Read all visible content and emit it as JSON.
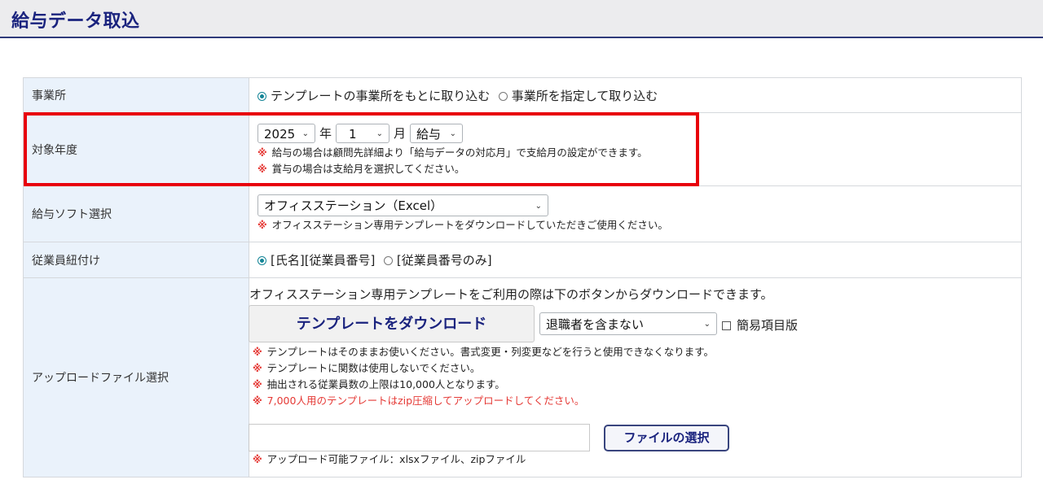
{
  "header": {
    "title": "給与データ取込"
  },
  "office": {
    "label": "事業所",
    "options": [
      {
        "label": "テンプレートの事業所をもとに取り込む",
        "checked": true
      },
      {
        "label": "事業所を指定して取り込む",
        "checked": false
      }
    ]
  },
  "target_year": {
    "label": "対象年度",
    "year": "2025",
    "year_unit": "年",
    "month": "1",
    "month_unit": "月",
    "kind": "給与",
    "notes": [
      "給与の場合は顧問先詳細より「給与データの対応月」で支給月の設定ができます。",
      "賞与の場合は支給月を選択してください。"
    ]
  },
  "software": {
    "label": "給与ソフト選択",
    "selected": "オフィスステーション（Excel）",
    "note": "オフィスステーション専用テンプレートをダウンロードしていただきご使用ください。"
  },
  "employee_link": {
    "label": "従業員紐付け",
    "options": [
      {
        "label": "[氏名][従業員番号]",
        "checked": true
      },
      {
        "label": "[従業員番号のみ]",
        "checked": false
      }
    ]
  },
  "upload": {
    "label": "アップロードファイル選択",
    "intro": "オフィスステーション専用テンプレートをご利用の際は下のボタンからダウンロードできます。",
    "download_button": "テンプレートをダウンロード",
    "retire_select": "退職者を含まない",
    "simple_checkbox": "簡易項目版",
    "notes": [
      "テンプレートはそのままお使いください。書式変更・列変更などを行うと使用できなくなります。",
      "テンプレートに関数は使用しないでください。",
      "抽出される従業員数の上限は10,000人となります。",
      "7,000人用のテンプレートはzip圧縮してアップロードしてください。"
    ],
    "file_button": "ファイルの選択",
    "file_note": "アップロード可能ファイル：xlsxファイル、zipファイル"
  },
  "note_mark": "※",
  "colors": {
    "accent": "#1a237e",
    "warning": "#e53935",
    "highlight": "#e8000b",
    "label_bg": "#eaf2fb"
  }
}
